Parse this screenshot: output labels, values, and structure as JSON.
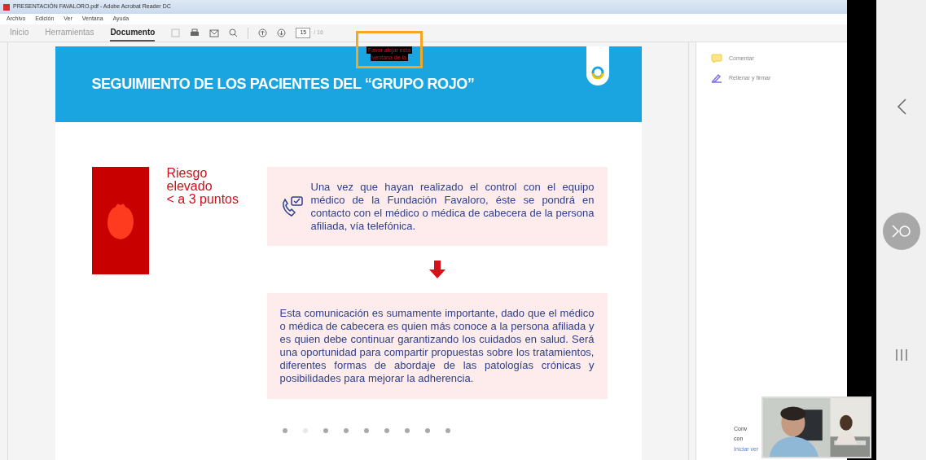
{
  "window": {
    "title": "PRESENTACIÓN FAVALORO.pdf - Adobe Acrobat Reader DC"
  },
  "menu": [
    "Archivo",
    "Edición",
    "Ver",
    "Ventana",
    "Ayuda"
  ],
  "tabs": [
    {
      "label": "Inicio",
      "selected": false
    },
    {
      "label": "Herramientas",
      "selected": false
    },
    {
      "label": "Documento",
      "selected": true
    }
  ],
  "page": {
    "current": "15",
    "total": "/ 16"
  },
  "overlay_note": {
    "lines": [
      "Favor alejar esta",
      "ventana de la"
    ]
  },
  "slide": {
    "title": "SEGUIMIENTO DE LOS PACIENTES DEL “GRUPO ROJO”",
    "risk": {
      "lines": [
        "Riesgo",
        "elevado",
        "< a 3 puntos"
      ]
    },
    "box1": "Una vez que hayan realizado el control con el equipo médico de la Fundación Favaloro, éste se pondrá en contacto con el médico o médica de cabecera de la persona afiliada, vía telefónica.",
    "box2": "Esta comunicación es sumamente importante, dado que el médico o médica de cabecera es quien más conoce a la persona afiliada y es quien debe continuar garantizando los cuidados en salud. Será una oportunidad para compartir propuestas sobre los tratamientos, diferentes formas de abordaje de las patologías crónicas y posibilidades para mejorar la adherencia.",
    "dots": [
      {
        "selected": false
      },
      {
        "selected": true
      },
      {
        "selected": false
      },
      {
        "selected": false
      },
      {
        "selected": false
      },
      {
        "selected": false
      },
      {
        "selected": false
      },
      {
        "selected": false
      },
      {
        "selected": false
      }
    ]
  },
  "tools_pane": {
    "items": [
      {
        "kind": "comment",
        "label": "Comentar"
      },
      {
        "kind": "sign",
        "label": "Rellenar y firmar"
      }
    ],
    "footer": [
      "Conv",
      "con",
      "Iniciar ver"
    ]
  }
}
